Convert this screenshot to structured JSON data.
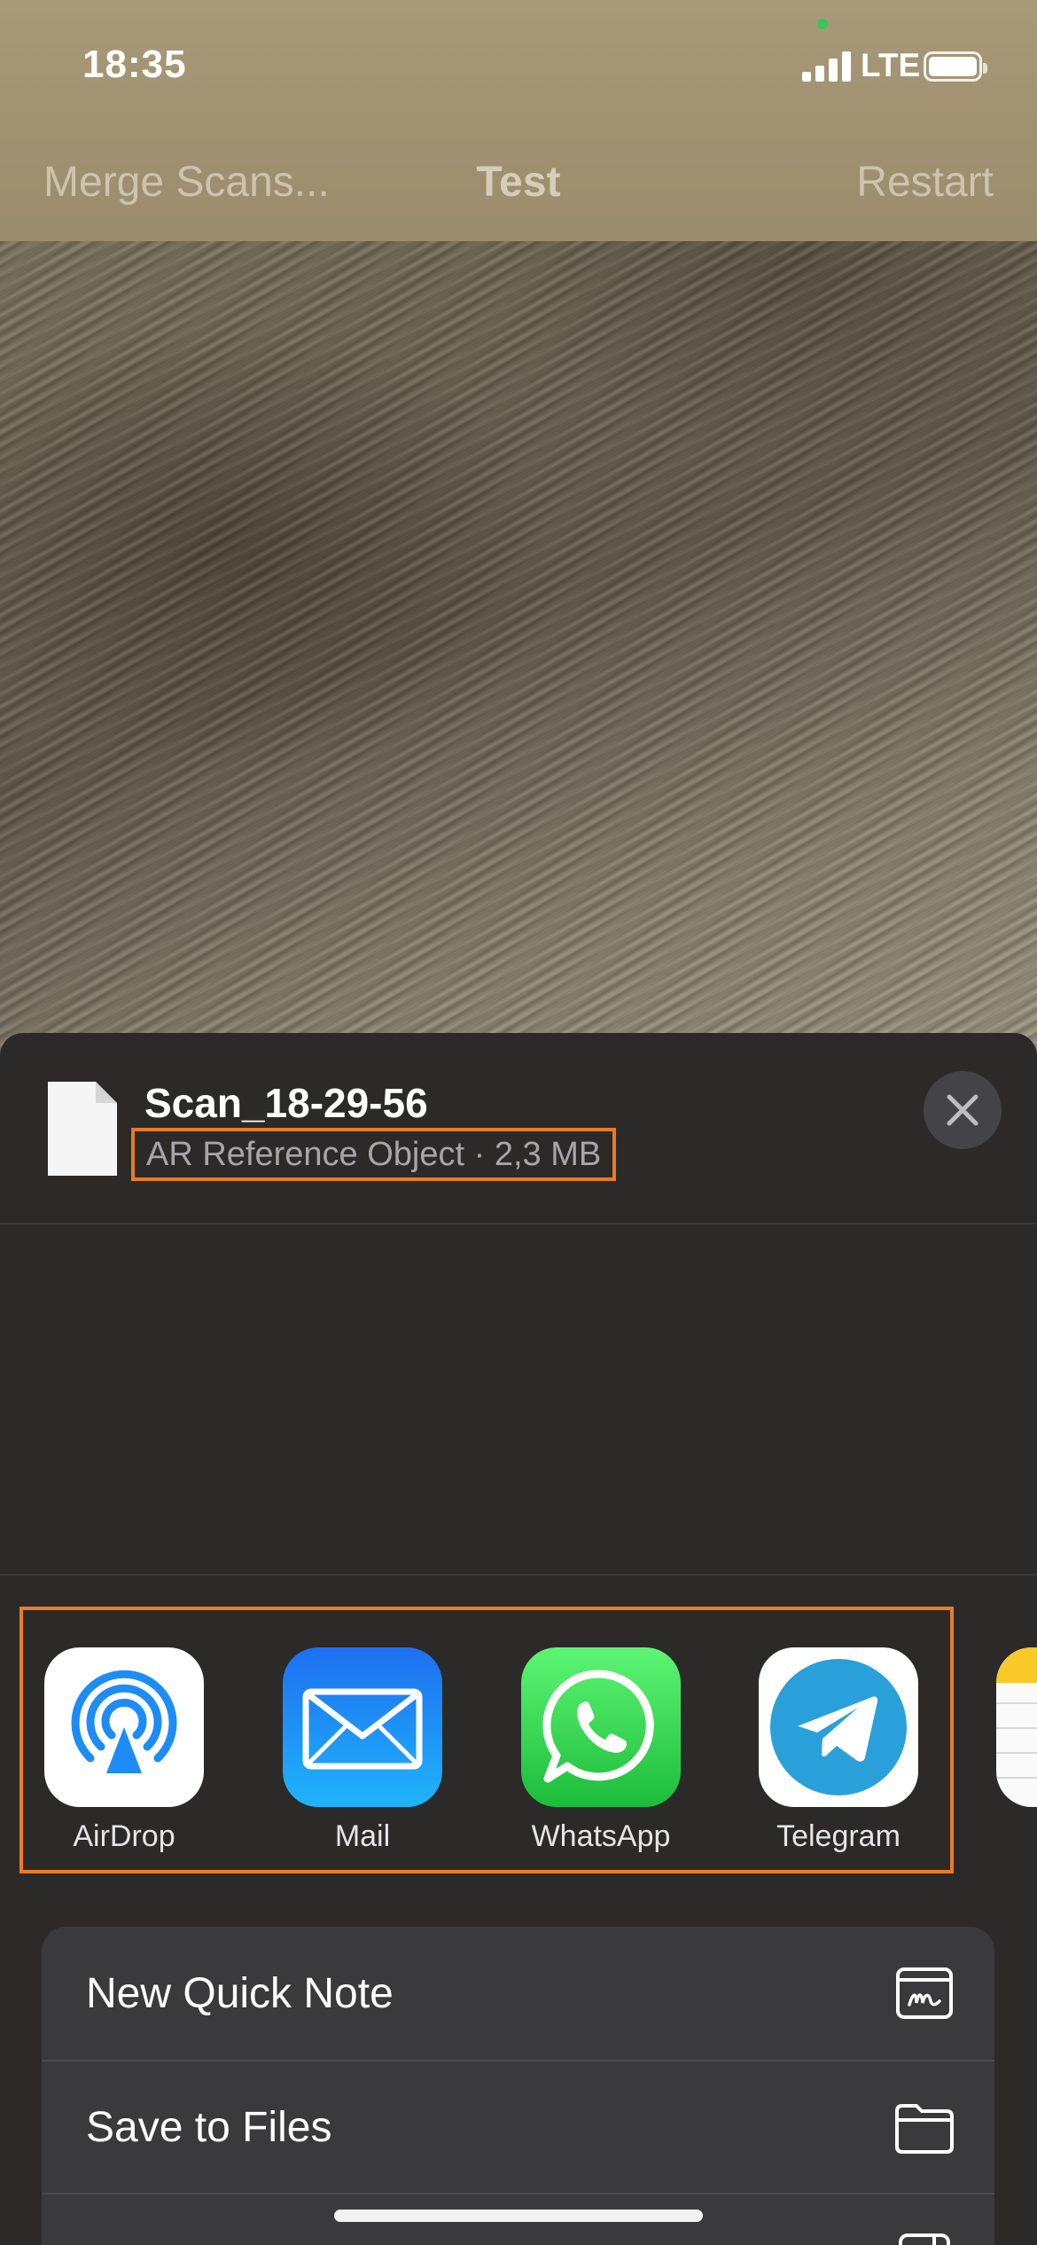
{
  "status_bar": {
    "time": "18:35",
    "network": "LTE"
  },
  "nav": {
    "left_button": "Merge Scans...",
    "title": "Test",
    "right_button": "Restart"
  },
  "share_sheet": {
    "file_name": "Scan_18-29-56",
    "file_meta": "AR Reference Object · 2,3 MB",
    "close_icon": "xmark-icon",
    "apps": [
      {
        "label": "AirDrop",
        "icon": "airdrop-icon"
      },
      {
        "label": "Mail",
        "icon": "mail-icon"
      },
      {
        "label": "WhatsApp",
        "icon": "whatsapp-icon"
      },
      {
        "label": "Telegram",
        "icon": "telegram-icon"
      }
    ],
    "actions": [
      {
        "label": "New Quick Note",
        "icon": "quick-note-icon"
      },
      {
        "label": "Save to Files",
        "icon": "folder-icon"
      }
    ]
  },
  "colors": {
    "highlight": "#ea7a23",
    "sheet_background": "#2b2a29",
    "action_group_background": "#3a3a3c"
  }
}
